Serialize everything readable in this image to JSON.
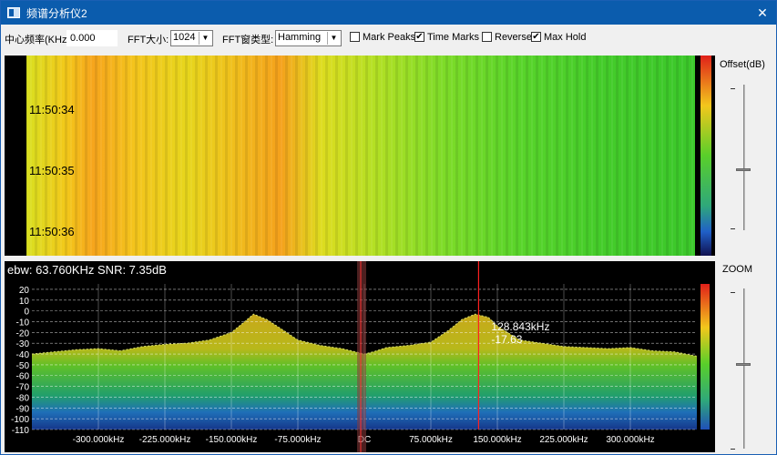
{
  "window": {
    "title": "频谱分析仪2",
    "close_glyph": "✕"
  },
  "toolbar": {
    "center_freq_label": "中心频率(KHz):",
    "center_freq_value": "0.000",
    "fft_size_label": "FFT大小:",
    "fft_size_value": "1024",
    "fft_window_label": "FFT窗类型:",
    "fft_window_value": "Hamming",
    "checkboxes": [
      {
        "label": "Mark Peaks",
        "checked": false
      },
      {
        "label": "Time Marks",
        "checked": true
      },
      {
        "label": "Reverse",
        "checked": false
      },
      {
        "label": "Max Hold",
        "checked": true
      }
    ]
  },
  "waterfall": {
    "time_marks": [
      "11:50:34",
      "11:50:35",
      "11:50:36"
    ]
  },
  "side": {
    "offset_label": "Offset(dB)",
    "zoom_label": "ZOOM"
  },
  "chart_data": {
    "type": "area",
    "title": "ebw: 63.760KHz SNR: 7.35dB",
    "ylim": [
      -110,
      25
    ],
    "y_ticks": [
      20,
      10,
      0,
      -10,
      -20,
      -30,
      -40,
      -50,
      -60,
      -70,
      -80,
      -90,
      -100,
      -110
    ],
    "x_tick_labels": [
      "-300.000kHz",
      "-225.000kHz",
      "-150.000kHz",
      "-75.000kHz",
      "DC",
      "75.000kHz",
      "150.000kHz",
      "225.000kHz",
      "300.000kHz"
    ],
    "x_tick_values": [
      -300,
      -225,
      -150,
      -75,
      0,
      75,
      150,
      225,
      300
    ],
    "xlim": [
      -375,
      375
    ],
    "cursor": {
      "freq_label": "128.843kHz",
      "level_label": "-17.63",
      "freq": 128.843
    },
    "envelope_x": [
      -375,
      -350,
      -325,
      -300,
      -275,
      -250,
      -225,
      -200,
      -175,
      -150,
      -135,
      -125,
      -110,
      -95,
      -75,
      -50,
      -25,
      -10,
      0,
      10,
      25,
      50,
      75,
      95,
      110,
      125,
      140,
      150,
      175,
      200,
      225,
      250,
      275,
      300,
      325,
      350,
      375
    ],
    "envelope_y": [
      -40,
      -38,
      -36,
      -35,
      -37,
      -33,
      -31,
      -30,
      -27,
      -20,
      -10,
      -3,
      -8,
      -16,
      -27,
      -32,
      -35,
      -38,
      -40,
      -38,
      -34,
      -32,
      -29,
      -18,
      -8,
      -3,
      -6,
      -14,
      -27,
      -30,
      -33,
      -34,
      -35,
      -34,
      -37,
      -38,
      -42
    ]
  }
}
